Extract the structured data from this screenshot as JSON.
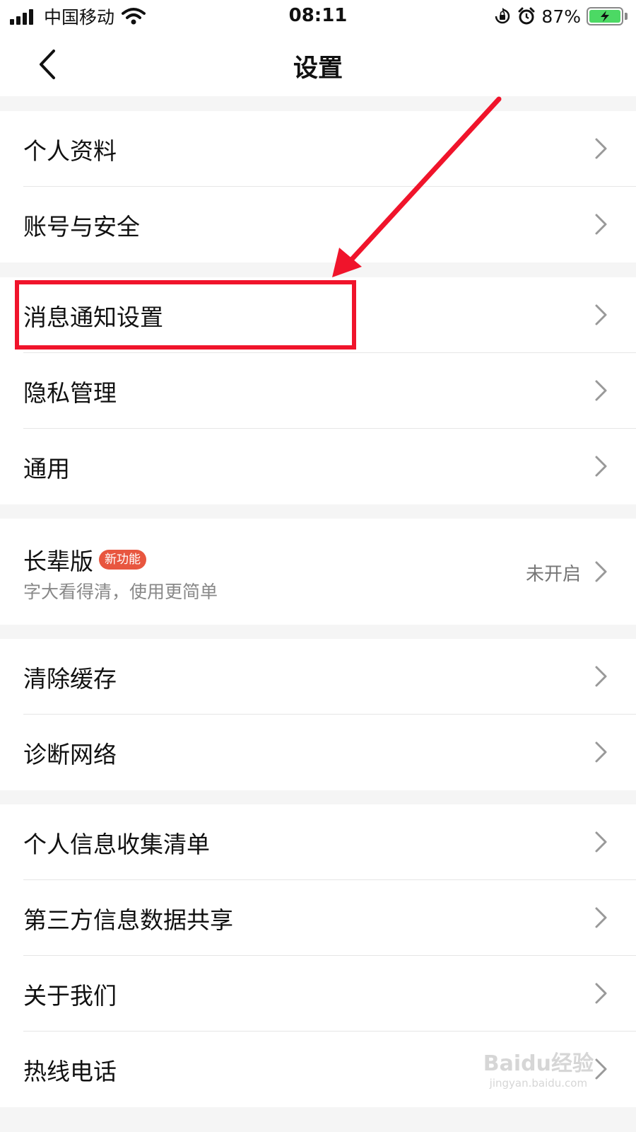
{
  "status_bar": {
    "carrier": "中国移动",
    "time": "08:11",
    "battery": "87%",
    "icons": [
      "signal-icon",
      "wifi-icon",
      "orientation-lock-icon",
      "alarm-icon",
      "battery-charging-icon"
    ]
  },
  "nav": {
    "title": "设置",
    "back_icon": "chevron-left-icon"
  },
  "groups": [
    {
      "items": [
        {
          "label": "个人资料"
        },
        {
          "label": "账号与安全"
        }
      ]
    },
    {
      "items": [
        {
          "label": "消息通知设置"
        },
        {
          "label": "隐私管理"
        },
        {
          "label": "通用"
        }
      ]
    },
    {
      "elder": {
        "label": "长辈版",
        "badge": "新功能",
        "subtitle": "字大看得清，使用更简单",
        "status": "未开启"
      }
    },
    {
      "items": [
        {
          "label": "清除缓存"
        },
        {
          "label": "诊断网络"
        }
      ]
    },
    {
      "items": [
        {
          "label": "个人信息收集清单"
        },
        {
          "label": "第三方信息数据共享"
        },
        {
          "label": "关于我们"
        },
        {
          "label": "热线电话"
        }
      ]
    }
  ],
  "annotation": {
    "highlight_target": "消息通知设置",
    "color": "#f0142b"
  },
  "watermark": {
    "brand": "Baidu经验",
    "url": "jingyan.baidu.com"
  },
  "colors": {
    "badge": "#e8563f",
    "battery": "#4cd964",
    "annotation": "#f0142b"
  }
}
